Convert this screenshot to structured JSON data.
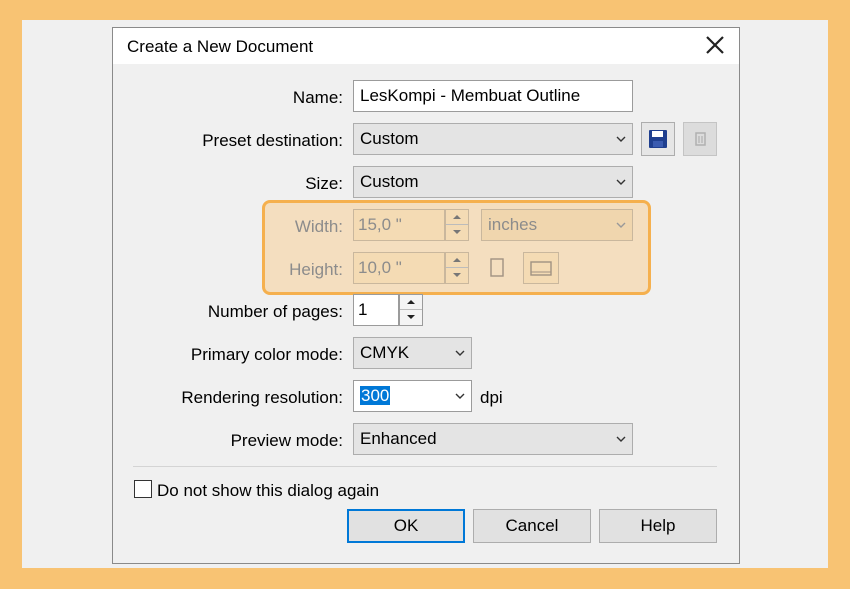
{
  "dialog": {
    "title": "Create a New Document",
    "close_glyph": "✕"
  },
  "form": {
    "name_label": "Name:",
    "name_value": "LesKompi - Membuat Outline",
    "preset_label": "Preset destination:",
    "preset_value": "Custom",
    "size_label": "Size:",
    "size_value": "Custom",
    "width_label": "Width:",
    "width_value": "15,0 \"",
    "units_value": "inches",
    "height_label": "Height:",
    "height_value": "10,0 \"",
    "pages_label": "Number of pages:",
    "pages_value": "1",
    "color_mode_label": "Primary color mode:",
    "color_mode_value": "CMYK",
    "resolution_label": "Rendering resolution:",
    "resolution_value": "300",
    "resolution_unit": "dpi",
    "preview_label": "Preview mode:",
    "preview_value": "Enhanced"
  },
  "footer": {
    "dont_show_label": "Do not show this dialog again",
    "ok_label": "OK",
    "cancel_label": "Cancel",
    "help_label": "Help"
  },
  "icons": {
    "save": "save-icon",
    "delete": "delete-icon",
    "portrait": "portrait-icon",
    "landscape": "landscape-icon"
  },
  "colors": {
    "background": "#f8c373",
    "highlight": "#f5b04e",
    "accent": "#0078d7"
  }
}
